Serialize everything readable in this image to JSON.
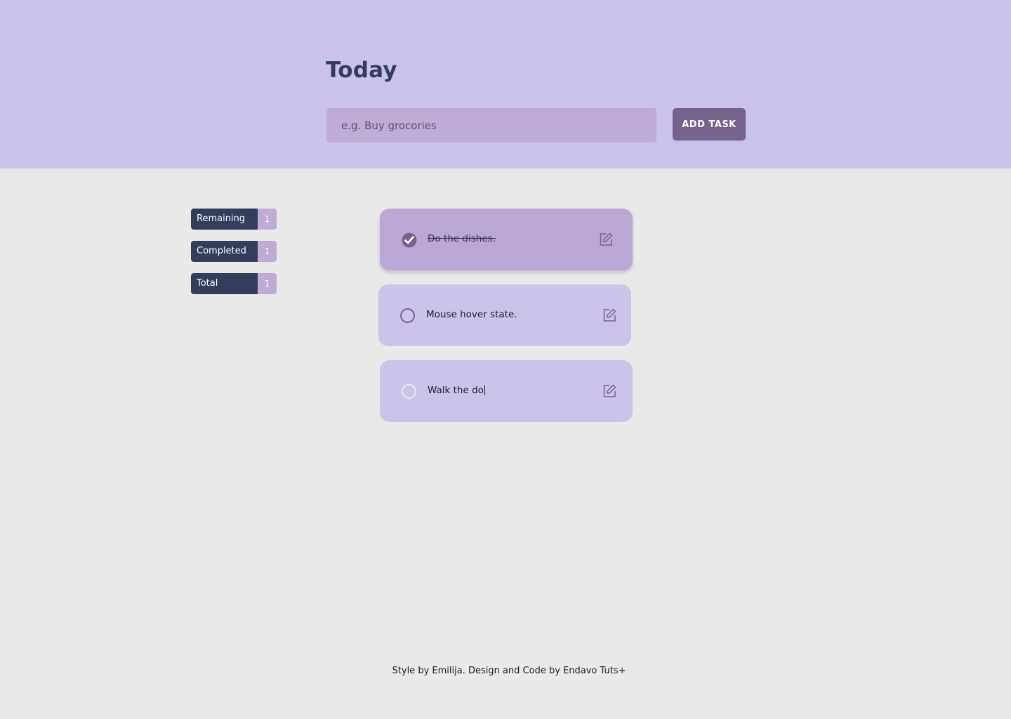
{
  "header": {
    "title": "Today",
    "input": {
      "placeholder": "e.g. Buy grocories",
      "value": ""
    },
    "add_button_label": "ADD TASK"
  },
  "stats": [
    {
      "label": "Remaining",
      "count": "1"
    },
    {
      "label": "Completed",
      "count": "1"
    },
    {
      "label": "Total",
      "count": "1"
    }
  ],
  "tasks": [
    {
      "text": "Do the dishes.",
      "completed": true,
      "state": "completed"
    },
    {
      "text": "Mouse hover state.",
      "completed": false,
      "state": "hover"
    },
    {
      "text": "Walk the do",
      "completed": false,
      "state": "editing"
    }
  ],
  "footer": {
    "text": "Style by Emilija. Design and Code by Endavo Tuts+"
  },
  "colors": {
    "header_bg": "#cbc4e8",
    "page_bg": "#e9e9e9",
    "accent": "#76638c",
    "stat_label_bg": "#343d5c",
    "stat_count_bg": "#bfacd5",
    "completed_card_bg": "#baa7d3"
  },
  "icons": {
    "checkbox_checked": "check-circle-icon",
    "checkbox_unchecked": "circle-icon",
    "edit": "edit-square-icon"
  }
}
